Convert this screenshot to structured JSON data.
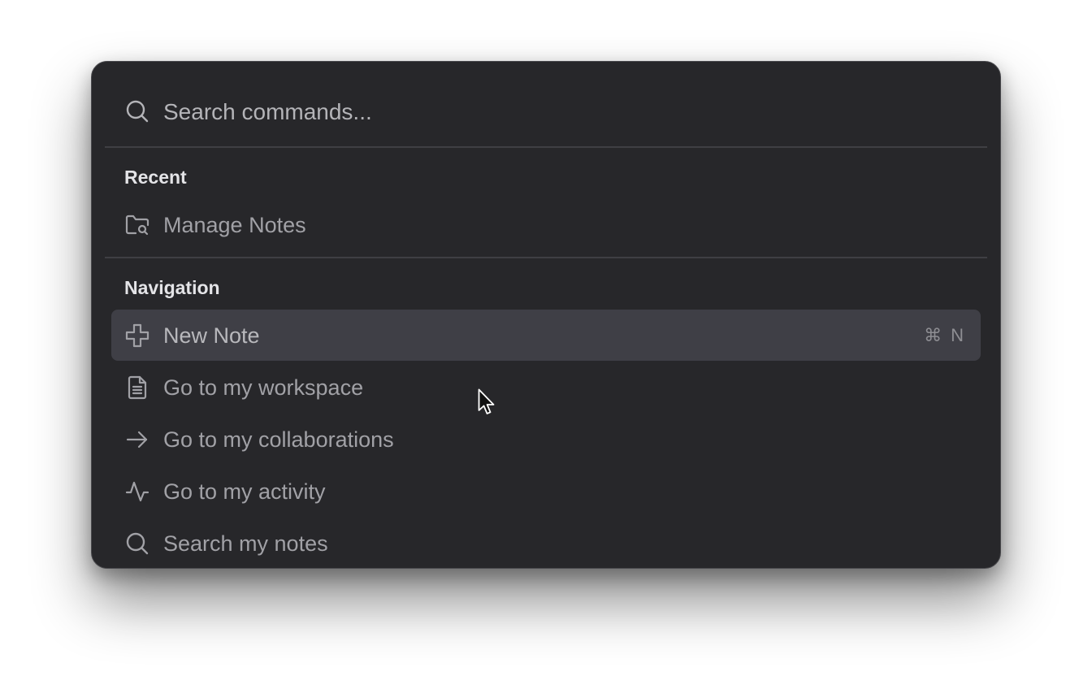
{
  "search": {
    "placeholder": "Search commands...",
    "value": "",
    "icon": "search-icon"
  },
  "sections": {
    "recent": {
      "title": "Recent",
      "items": [
        {
          "label": "Manage Notes",
          "icon": "folder-search-icon"
        }
      ]
    },
    "navigation": {
      "title": "Navigation",
      "items": [
        {
          "label": "New Note",
          "icon": "plus-icon",
          "selected": true,
          "shortcut": {
            "modifier": "⌘",
            "key": "N"
          }
        },
        {
          "label": "Go to my workspace",
          "icon": "document-icon"
        },
        {
          "label": "Go to my collaborations",
          "icon": "arrow-right-icon"
        },
        {
          "label": "Go to my activity",
          "icon": "activity-icon"
        },
        {
          "label": "Search my notes",
          "icon": "search-icon"
        }
      ]
    }
  },
  "colors": {
    "panel_background": "#27272a",
    "selected_row": "#3f3f46",
    "divider": "#3f3f43",
    "text_muted": "#a1a1a6",
    "heading": "#e4e4e7"
  }
}
